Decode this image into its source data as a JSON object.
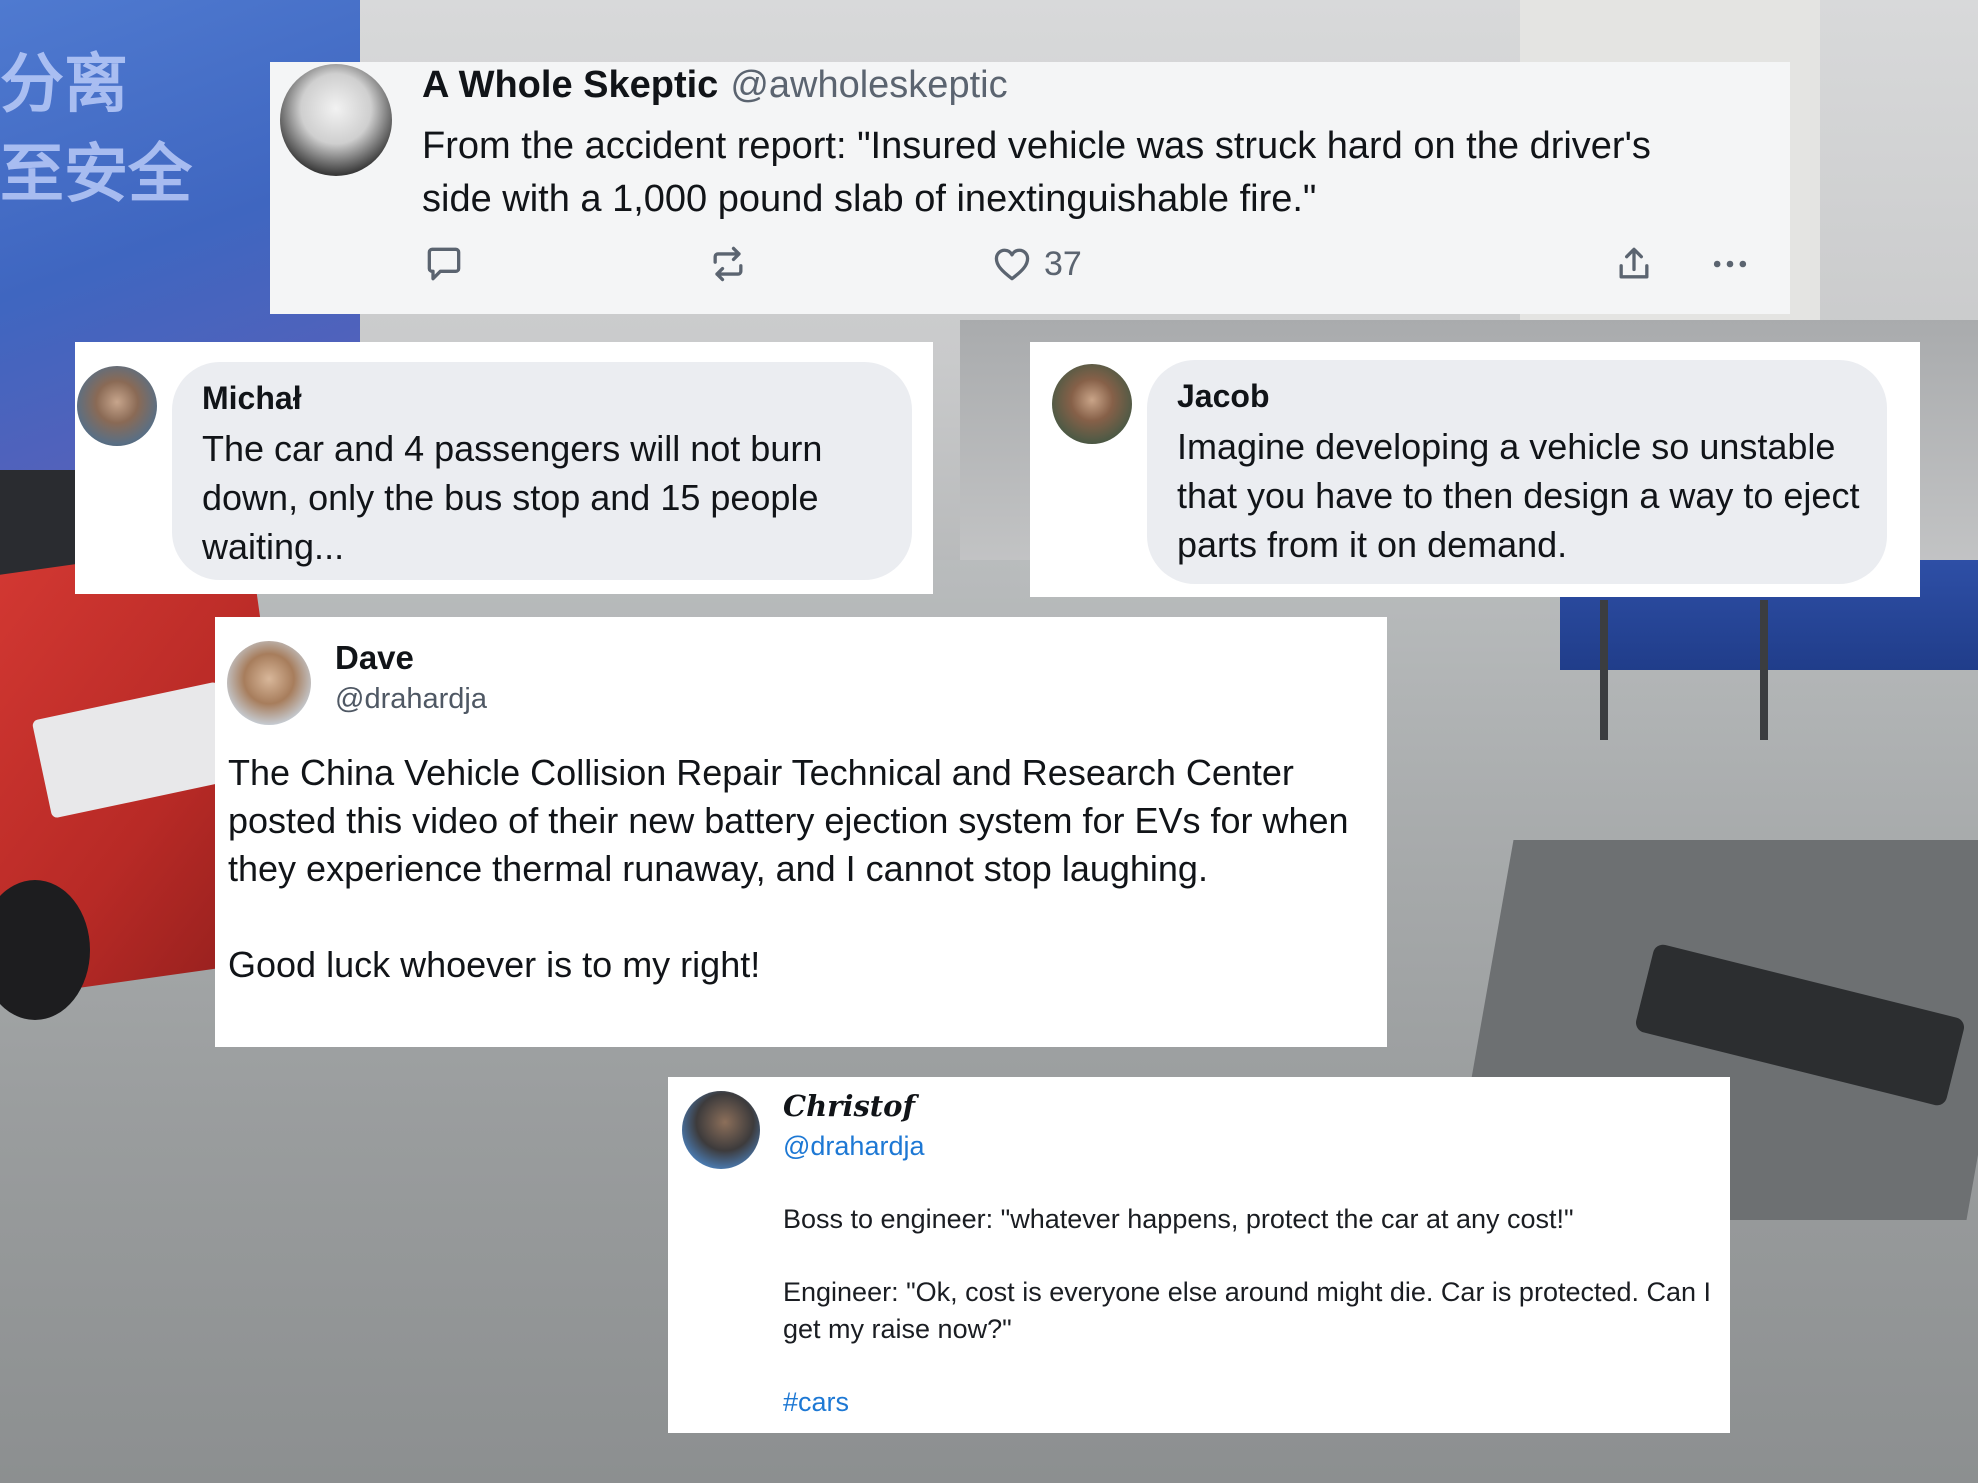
{
  "background": {
    "banner_text": "分离\n至安全"
  },
  "post_main": {
    "author_name": "A Whole Skeptic",
    "author_handle": "@awholeskeptic",
    "text": "From the accident report: \"Insured vehicle was struck hard on the driver's side with a 1,000 pound slab of inextinguishable fire.\"",
    "likes": "37",
    "icons": [
      "reply-icon",
      "repost-icon",
      "heart-icon",
      "share-icon",
      "more-icon"
    ]
  },
  "reply_michal": {
    "author_name": "Michał",
    "text": "The car and 4 passengers will not burn down, only the bus stop and 15 people waiting..."
  },
  "reply_jacob": {
    "author_name": "Jacob",
    "text": "Imagine developing a vehicle so unstable that you have to then design a way to eject parts from it on demand."
  },
  "post_dave": {
    "author_name": "Dave",
    "author_handle": "@drahardja",
    "text": "The China Vehicle Collision Repair Technical and Research Center posted this video of their new battery ejection system for EVs for when they experience thermal runaway, and I cannot stop laughing.\n\nGood luck whoever is to my right!"
  },
  "post_christof": {
    "author_name": "Christof",
    "author_handle": "@drahardja",
    "line1": "Boss to engineer: \"whatever happens, protect the car at any cost!\"",
    "line2": "Engineer: \"Ok, cost is everyone else around might die. Car is protected. Can I get my raise now?\"",
    "hashtag": "#cars"
  },
  "colors": {
    "link_blue": "#1d78d4",
    "text_dark": "#111418",
    "muted": "#5b6470",
    "bubble_bg": "#ebedf1"
  }
}
